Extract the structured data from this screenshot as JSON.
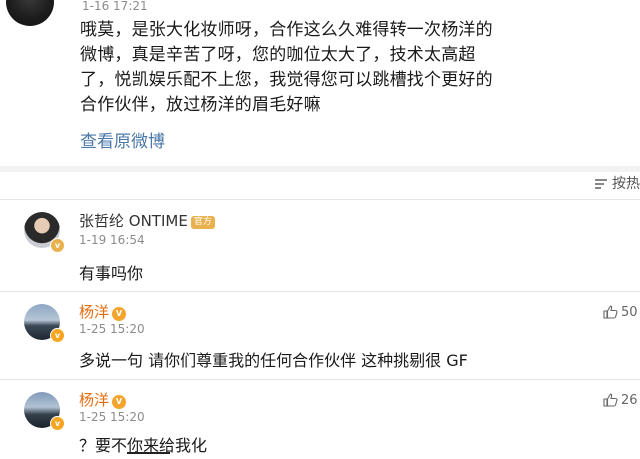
{
  "post": {
    "time": "1-16 17:21",
    "text": "哦莫，是张大化妆师呀，合作这么久难得转一次杨洋的微博，真是辛苦了呀，您的咖位太大了，技术太高超了，悦凯娱乐配不上您，我觉得您可以跳槽找个更好的合作伙伴，放过杨洋的眉毛好嘛",
    "view_original": "查看原微博"
  },
  "sort": {
    "label": "按热"
  },
  "comments": [
    {
      "name": "张哲纶 ONTIME",
      "badge": "官方",
      "time": "1-19 16:54",
      "text": "有事吗你",
      "likes": ""
    },
    {
      "name": "杨洋",
      "badge": "V",
      "time": "1-25 15:20",
      "text": "多说一句 请你们尊重我的任何合作伙伴 这种挑剔很 GF",
      "likes": "50"
    },
    {
      "name": "杨洋",
      "badge": "V",
      "time": "1-25 15:20",
      "text": "？要不你来给我化",
      "likes": "26"
    }
  ],
  "colors": {
    "link": "#4a78a8",
    "vip_name": "#e86b0b",
    "badge": "#f3a52c"
  }
}
